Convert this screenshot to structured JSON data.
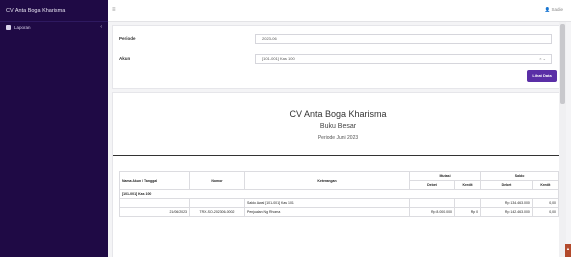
{
  "app": {
    "brand": "CV Anta Boga Kharisma",
    "user": "Sadie"
  },
  "sidebar": {
    "items": [
      {
        "label": "Laporan",
        "chevron": "‹"
      }
    ]
  },
  "filter": {
    "period_label": "Periode",
    "period_value": "2023-06",
    "account_label": "Akun",
    "account_value": "[101-001] Kas 100",
    "button_label": "Lihat Data"
  },
  "report": {
    "company": "CV Anta Boga Kharisma",
    "title": "Buku Besar",
    "period": "Periode Juni 2023",
    "headers": {
      "account_date": "Nama Akun / Tanggal",
      "number": "Nomor",
      "description": "Keterangan",
      "mutation": "Mutasi",
      "balance": "Saldo",
      "debit": "Debet",
      "credit": "Kredit"
    },
    "group_label": "[101-001] Kas 100",
    "rows": [
      {
        "date": "",
        "number": "",
        "description": "Saldo Awal [101-001] Kas 101",
        "mut_debit": "",
        "mut_credit": "",
        "bal_debit": "Rp 134.463.000",
        "bal_credit": "0,00"
      },
      {
        "date": "21/06/2023",
        "number": "TRX-SO-202306-0002",
        "description": "Penjualan Ng Rhoma",
        "mut_debit": "Rp 8.000.000",
        "mut_credit": "Rp 0",
        "bal_debit": "Rp 142.463.000",
        "bal_credit": "0,00"
      }
    ]
  }
}
